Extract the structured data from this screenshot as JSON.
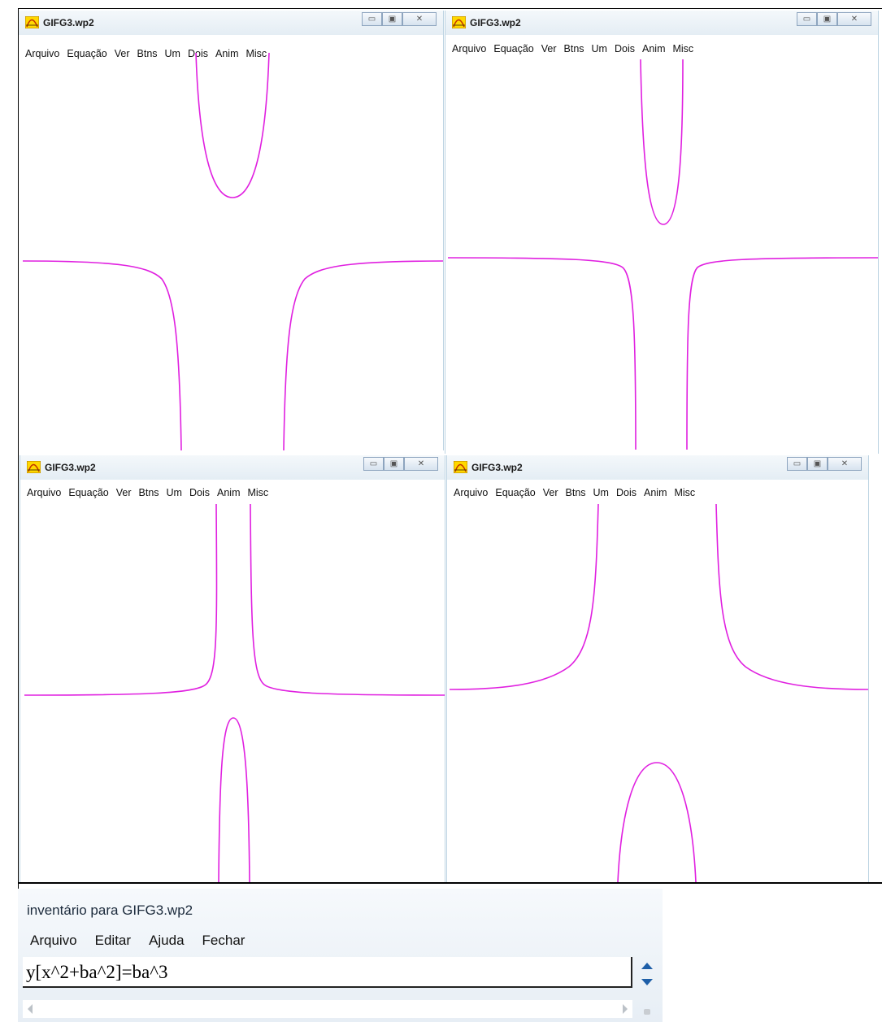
{
  "windows": [
    {
      "title": "GIFG3.wp2",
      "menu": [
        "Arquivo",
        "Equação",
        "Ver",
        "Btns",
        "Um",
        "Dois",
        "Anim",
        "Misc"
      ]
    },
    {
      "title": "GIFG3.wp2",
      "menu": [
        "Arquivo",
        "Equação",
        "Ver",
        "Btns",
        "Um",
        "Dois",
        "Anim",
        "Misc"
      ]
    },
    {
      "title": "GIFG3.wp2",
      "menu": [
        "Arquivo",
        "Equação",
        "Ver",
        "Btns",
        "Um",
        "Dois",
        "Anim",
        "Misc"
      ]
    },
    {
      "title": "GIFG3.wp2",
      "menu": [
        "Arquivo",
        "Equação",
        "Ver",
        "Btns",
        "Um",
        "Dois",
        "Anim",
        "Misc"
      ]
    }
  ],
  "inventory": {
    "title": "inventário para GIFG3.wp2",
    "menu": [
      "Arquivo",
      "Editar",
      "Ajuda",
      "Fechar"
    ],
    "equation": "y[x^2+ba^2]=ba^3"
  },
  "colors": {
    "curve": "#e020e0",
    "border": "#bcd3e2"
  },
  "icons": [
    "app-icon",
    "minimize-icon",
    "maximize-icon",
    "close-icon",
    "scroll-up-icon",
    "scroll-down-icon",
    "scroll-left-icon",
    "scroll-right-icon"
  ]
}
